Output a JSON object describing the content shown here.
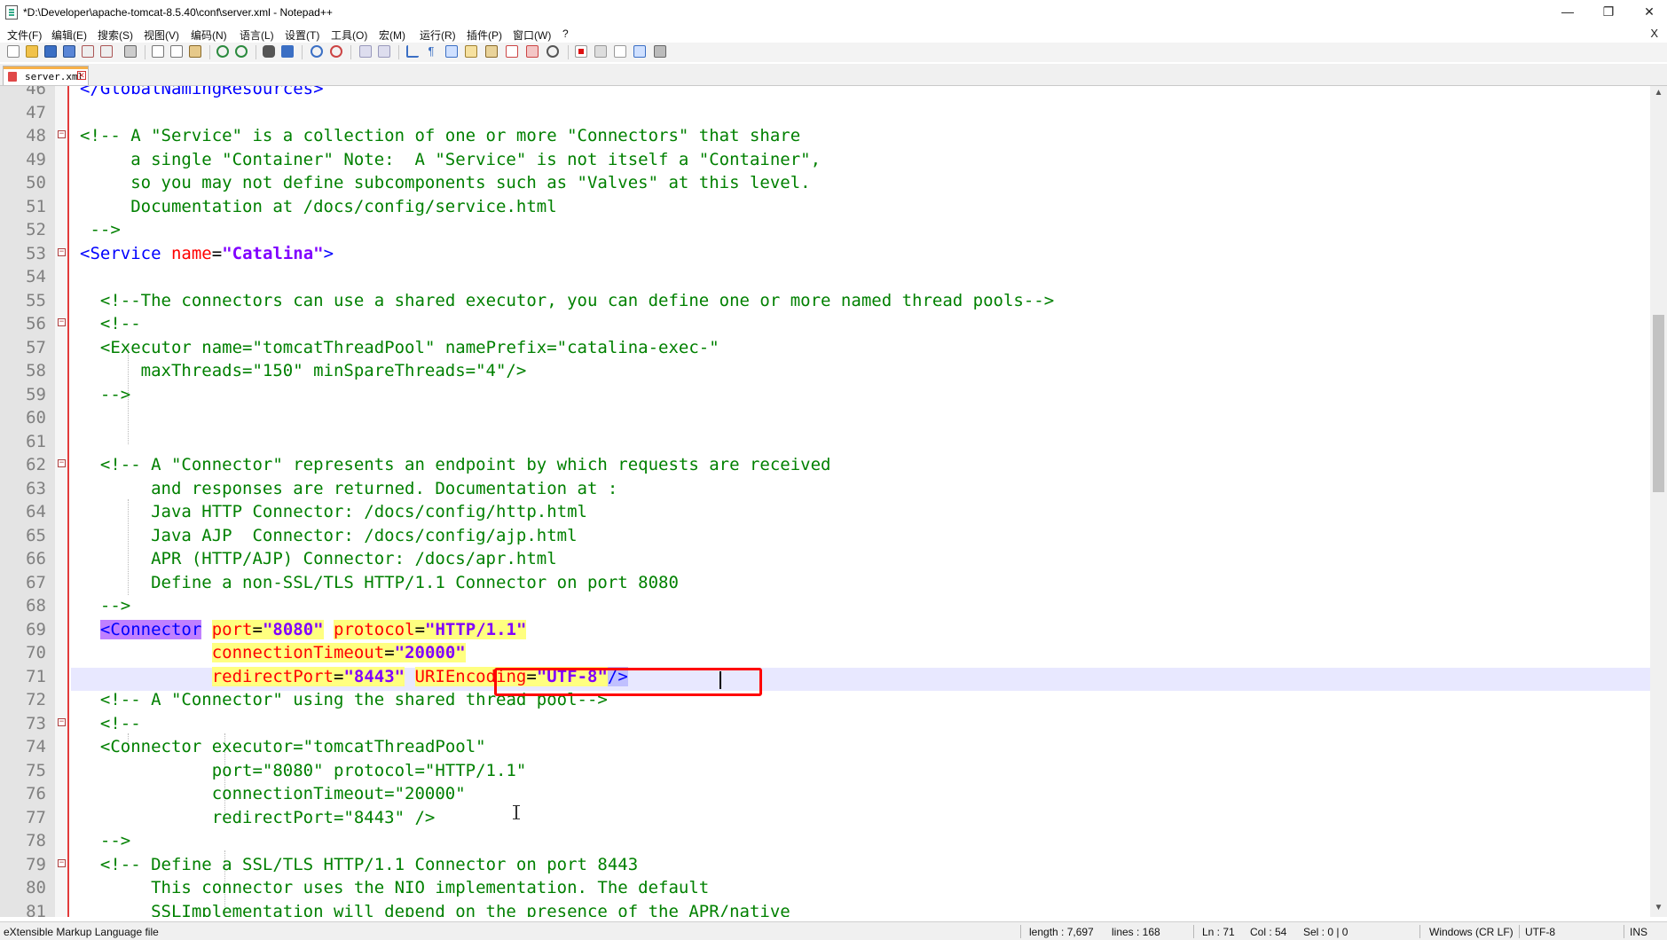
{
  "window": {
    "title": "*D:\\Developer\\apache-tomcat-8.5.40\\conf\\server.xml - Notepad++",
    "minimize": "—",
    "maximize": "❐",
    "close": "✕"
  },
  "menu": {
    "items": [
      "文件(F)",
      "编辑(E)",
      "搜索(S)",
      "视图(V)",
      "编码(N)",
      "语言(L)",
      "设置(T)",
      "工具(O)",
      "宏(M)",
      "运行(R)",
      "插件(P)",
      "窗口(W)",
      "?"
    ],
    "doc_close": "X"
  },
  "toolbar": {
    "icons": [
      "new-file-icon",
      "open-file-icon",
      "save-icon",
      "save-all-icon",
      "close-icon",
      "close-all-icon",
      "print-icon",
      "cut-icon",
      "copy-icon",
      "paste-icon",
      "undo-icon",
      "redo-icon",
      "find-icon",
      "replace-icon",
      "zoom-in-icon",
      "zoom-out-icon",
      "sync-vertical-icon",
      "sync-horizontal-icon",
      "word-wrap-icon",
      "show-all-chars-icon",
      "indent-guide-icon",
      "user-language-icon",
      "doc-map-icon",
      "function-list-icon",
      "folder-workspace-icon",
      "monitoring-icon",
      "record-macro-icon",
      "stop-record-icon",
      "play-macro-icon",
      "run-macro-multiple-icon",
      "save-macro-icon"
    ]
  },
  "tab": {
    "label": "server.xml",
    "close": "✕"
  },
  "editor": {
    "lines": [
      {
        "n": "46",
        "fold": "",
        "html": "<span class=\"t-tag\">&lt;/GlobalNamingResources&gt;</span>"
      },
      {
        "n": "47",
        "fold": "",
        "html": ""
      },
      {
        "n": "48",
        "fold": "⊟",
        "html": "<span class=\"t-cmt\">&lt;!-- A \"Service\" is a collection of one or more \"Connectors\" that share</span>"
      },
      {
        "n": "49",
        "fold": "",
        "html": "<span class=\"t-cmt\">     a single \"Container\" Note:  A \"Service\" is not itself a \"Container\",</span>"
      },
      {
        "n": "50",
        "fold": "",
        "html": "<span class=\"t-cmt\">     so you may not define subcomponents such as \"Valves\" at this level.</span>"
      },
      {
        "n": "51",
        "fold": "",
        "html": "<span class=\"t-cmt\">     Documentation at /docs/config/service.html</span>"
      },
      {
        "n": "52",
        "fold": "",
        "html": "<span class=\"t-cmt\"> --&gt;</span>"
      },
      {
        "n": "53",
        "fold": "⊟",
        "html": "<span class=\"t-tag\">&lt;Service</span> <span class=\"t-attr\">name</span><span class=\"t-punc\">=</span><span class=\"t-val\">\"Catalina\"</span><span class=\"t-tag\">&gt;</span>"
      },
      {
        "n": "54",
        "fold": "",
        "html": ""
      },
      {
        "n": "55",
        "fold": "",
        "html": "  <span class=\"t-cmt\">&lt;!--The connectors can use a shared executor, you can define one or more named thread pools--&gt;</span>"
      },
      {
        "n": "56",
        "fold": "⊟",
        "html": "  <span class=\"t-cmt\">&lt;!--</span>"
      },
      {
        "n": "57",
        "fold": "",
        "html": "  <span class=\"t-cmt\">&lt;Executor name=\"tomcatThreadPool\" namePrefix=\"catalina-exec-\"</span>"
      },
      {
        "n": "58",
        "fold": "",
        "html": "<span class=\"t-cmt\">      maxThreads=\"150\" minSpareThreads=\"4\"/&gt;</span>"
      },
      {
        "n": "59",
        "fold": "",
        "html": "  <span class=\"t-cmt\">--&gt;</span>"
      },
      {
        "n": "60",
        "fold": "",
        "html": ""
      },
      {
        "n": "61",
        "fold": "",
        "html": ""
      },
      {
        "n": "62",
        "fold": "⊟",
        "html": "  <span class=\"t-cmt\">&lt;!-- A \"Connector\" represents an endpoint by which requests are received</span>"
      },
      {
        "n": "63",
        "fold": "",
        "html": "<span class=\"t-cmt\">       and responses are returned. Documentation at :</span>"
      },
      {
        "n": "64",
        "fold": "",
        "html": "<span class=\"t-cmt\">       Java HTTP Connector: /docs/config/http.html</span>"
      },
      {
        "n": "65",
        "fold": "",
        "html": "<span class=\"t-cmt\">       Java AJP  Connector: /docs/config/ajp.html</span>"
      },
      {
        "n": "66",
        "fold": "",
        "html": "<span class=\"t-cmt\">       APR (HTTP/AJP) Connector: /docs/apr.html</span>"
      },
      {
        "n": "67",
        "fold": "",
        "html": "<span class=\"t-cmt\">       Define a non-SSL/TLS HTTP/1.1 Connector on port 8080</span>"
      },
      {
        "n": "68",
        "fold": "",
        "html": "  <span class=\"t-cmt\">--&gt;</span>"
      },
      {
        "n": "69",
        "fold": "",
        "html": "  <span class=\"t-tag hl-tag\">&lt;Connector</span> <span class=\"hl-yel\"><span class=\"t-attr\">port</span><span class=\"t-punc\">=</span><span class=\"t-val\">\"8080\"</span></span> <span class=\"hl-yel\"><span class=\"t-attr\">protocol</span><span class=\"t-punc\">=</span><span class=\"t-val\">\"HTTP/1.1\"</span></span>"
      },
      {
        "n": "70",
        "fold": "",
        "html": "             <span class=\"hl-yel\"><span class=\"t-attr\">connectionTimeout</span><span class=\"t-punc\">=</span><span class=\"t-val\">\"20000\"</span></span>"
      },
      {
        "n": "71",
        "fold": "",
        "html": "             <span class=\"hl-yel\"><span class=\"t-attr\">redirectPort</span><span class=\"t-punc\">=</span><span class=\"t-val\">\"8443\"</span></span> <span class=\"hl-yel\"><span class=\"t-attr\">URIEncoding</span><span class=\"t-punc\">=</span><span class=\"t-val\">\"UTF-8\"</span></span><span class=\"t-tag hl-sel\">/&gt;</span>"
      },
      {
        "n": "72",
        "fold": "",
        "html": "  <span class=\"t-cmt\">&lt;!-- A \"Connector\" using the shared thread pool--&gt;</span>"
      },
      {
        "n": "73",
        "fold": "⊟",
        "html": "  <span class=\"t-cmt\">&lt;!--</span>"
      },
      {
        "n": "74",
        "fold": "",
        "html": "  <span class=\"t-cmt\">&lt;Connector executor=\"tomcatThreadPool\"</span>"
      },
      {
        "n": "75",
        "fold": "",
        "html": "<span class=\"t-cmt\">             port=\"8080\" protocol=\"HTTP/1.1\"</span>"
      },
      {
        "n": "76",
        "fold": "",
        "html": "<span class=\"t-cmt\">             connectionTimeout=\"20000\"</span>"
      },
      {
        "n": "77",
        "fold": "",
        "html": "<span class=\"t-cmt\">             redirectPort=\"8443\" /&gt;</span>"
      },
      {
        "n": "78",
        "fold": "",
        "html": "  <span class=\"t-cmt\">--&gt;</span>"
      },
      {
        "n": "79",
        "fold": "⊟",
        "html": "  <span class=\"t-cmt\">&lt;!-- Define a SSL/TLS HTTP/1.1 Connector on port 8443</span>"
      },
      {
        "n": "80",
        "fold": "",
        "html": "<span class=\"t-cmt\">       This connector uses the NIO implementation. The default</span>"
      },
      {
        "n": "81",
        "fold": "",
        "html": "<span class=\"t-cmt\">       SSLImplementation will depend on the presence of the APR/native</span>"
      }
    ]
  },
  "status": {
    "filetype": "eXtensible Markup Language file",
    "length": "length : 7,697",
    "lines": "lines : 168",
    "ln": "Ln : 71",
    "col": "Col : 54",
    "sel": "Sel : 0 | 0",
    "eol": "Windows (CR LF)",
    "encoding": "UTF-8",
    "mode": "INS"
  }
}
